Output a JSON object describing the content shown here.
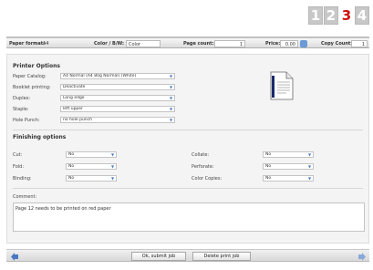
{
  "steps": [
    "1",
    "2",
    "3",
    "4"
  ],
  "active_step": "3",
  "infobar": {
    "paper_format_label": "Paper format:",
    "paper_format_value": "A4",
    "color_label": "Color / B/W:",
    "color_value": "Color",
    "page_count_label": "Page count:",
    "page_count_value": "1",
    "price_label": "Price:",
    "price_value": "0.00",
    "copy_count_label": "Copy Count:",
    "copy_count_value": "1"
  },
  "printer_options": {
    "title": "Printer Options",
    "rows": [
      {
        "label": "Paper Catalog:",
        "value": "A4 Normal (A4 80g Normal) (White)"
      },
      {
        "label": "Booklet printing:",
        "value": "Deactivate"
      },
      {
        "label": "Duplex:",
        "value": "Long edge"
      },
      {
        "label": "Staple:",
        "value": "left upper"
      },
      {
        "label": "Hole Punch:",
        "value": "no hole punch"
      }
    ]
  },
  "finishing_options": {
    "title": "Finishing options",
    "left": [
      {
        "label": "Cut:",
        "value": "No"
      },
      {
        "label": "Fold:",
        "value": "No"
      },
      {
        "label": "Binding:",
        "value": "No"
      }
    ],
    "right": [
      {
        "label": "Collate:",
        "value": "No"
      },
      {
        "label": "Perforate:",
        "value": "No"
      },
      {
        "label": "Color Copies:",
        "value": "No"
      }
    ]
  },
  "comment": {
    "label": "Comment:",
    "value": "Page 12 needs to be printed on red paper"
  },
  "buttons": {
    "submit": "Ok, submit job",
    "delete": "Delete print job"
  },
  "colors": {
    "accent_red": "#d01010",
    "dropdown_arrow": "#4a77c4"
  }
}
